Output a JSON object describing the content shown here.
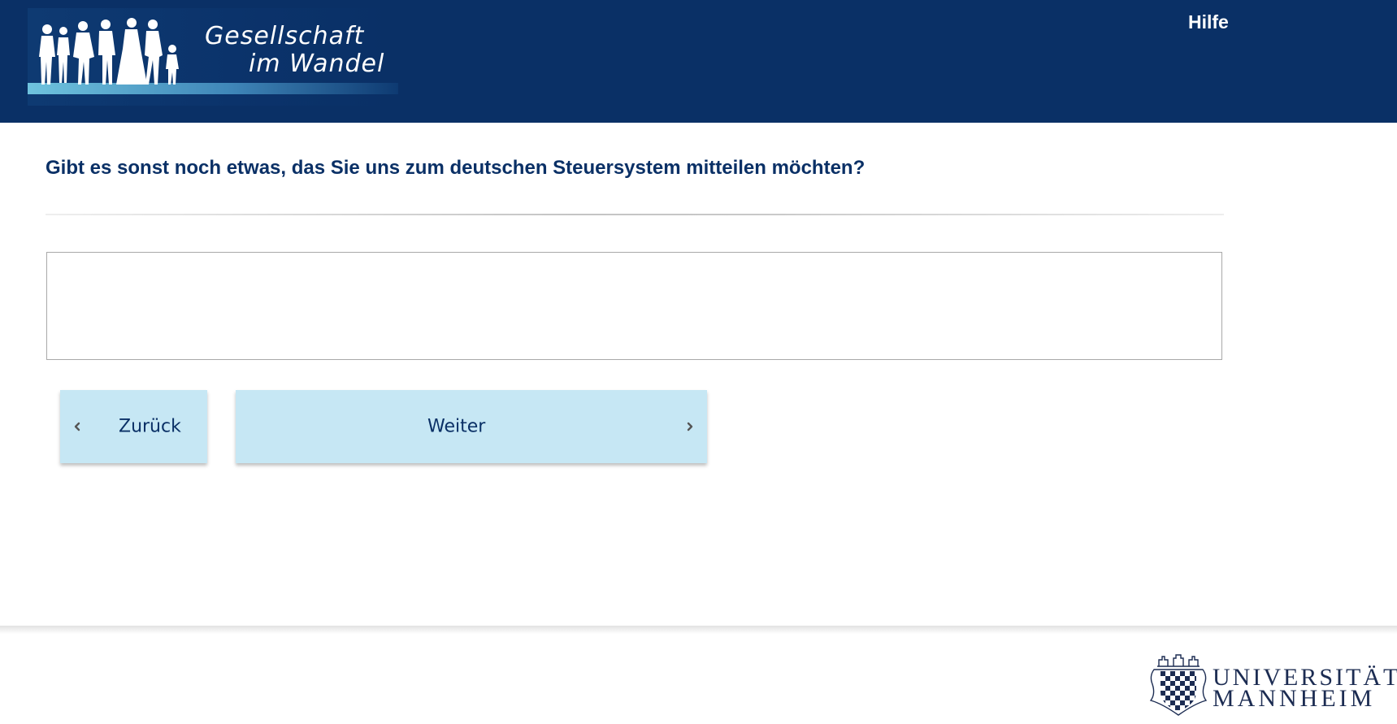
{
  "header": {
    "logo": {
      "line1": "Gesellschaft",
      "line2": "im Wandel",
      "icon": "people-silhouettes-icon"
    },
    "help_label": "Hilfe"
  },
  "main": {
    "question": "Gibt es sonst noch etwas, das Sie uns zum deutschen Steuersystem mitteilen möchten?",
    "answer_value": ""
  },
  "navigation": {
    "back_label": "Zurück",
    "back_icon": "chevron-left-icon",
    "next_label": "Weiter",
    "next_icon": "chevron-right-icon"
  },
  "footer": {
    "university_line1": "UNIVERSITÄT",
    "university_line2": "MANNHEIM",
    "crest_icon": "university-crest-icon"
  },
  "colors": {
    "header_bg": "#0a3066",
    "question_text": "#0a3066",
    "button_bg": "#c6e7f4",
    "university_text": "#1c2c52"
  }
}
